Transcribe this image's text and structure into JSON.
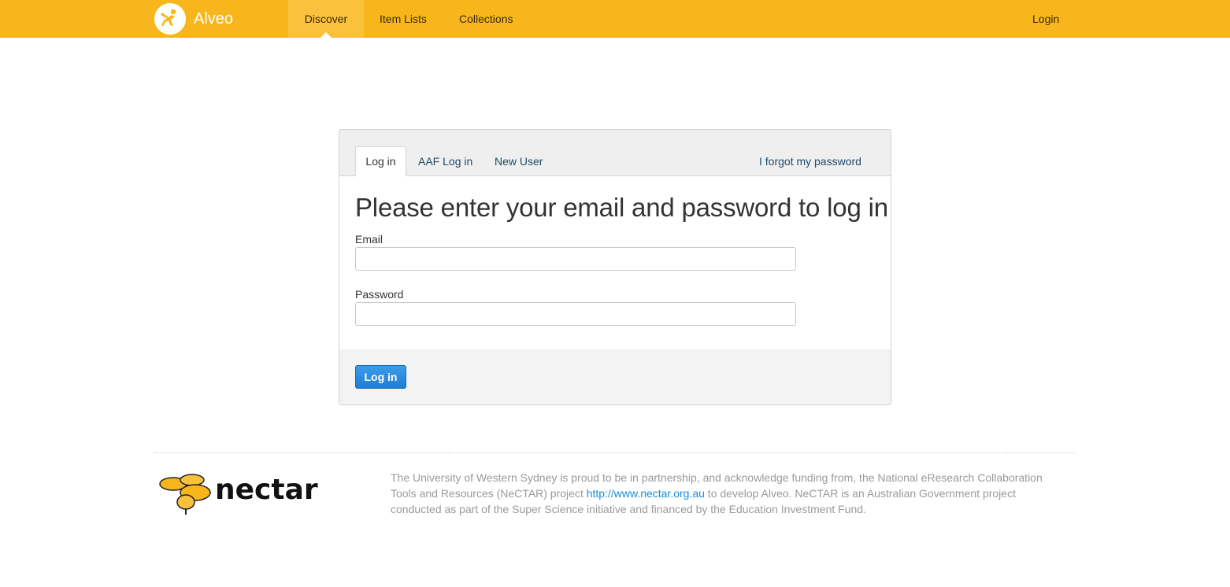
{
  "navbar": {
    "brand": "Alveo",
    "items": [
      {
        "label": "Discover",
        "active": true
      },
      {
        "label": "Item Lists"
      },
      {
        "label": "Collections"
      }
    ],
    "login": "Login"
  },
  "login_panel": {
    "tabs": [
      {
        "label": "Log in",
        "active": true
      },
      {
        "label": "AAF Log in"
      },
      {
        "label": "New User"
      }
    ],
    "forgot_password": "I forgot my password",
    "title": "Please enter your email and password to log in",
    "email_label": "Email",
    "email_value": "",
    "password_label": "Password",
    "password_value": "",
    "submit_label": "Log in"
  },
  "footer": {
    "logo_text": "nectar",
    "text_before_link": "The University of Western Sydney is proud to be in partnership, and acknowledge funding from, the National eResearch Collaboration Tools and Resources (NeCTAR) project ",
    "link_text": "http://www.nectar.org.au",
    "text_after_link": " to develop Alveo. NeCTAR is an Australian Government project conducted as part of the Super Science initiative and financed by the Education Investment Fund."
  },
  "colors": {
    "navbar": "#f7b71c",
    "primary_button": "#1f7dd6",
    "link": "#1a8fd8"
  }
}
